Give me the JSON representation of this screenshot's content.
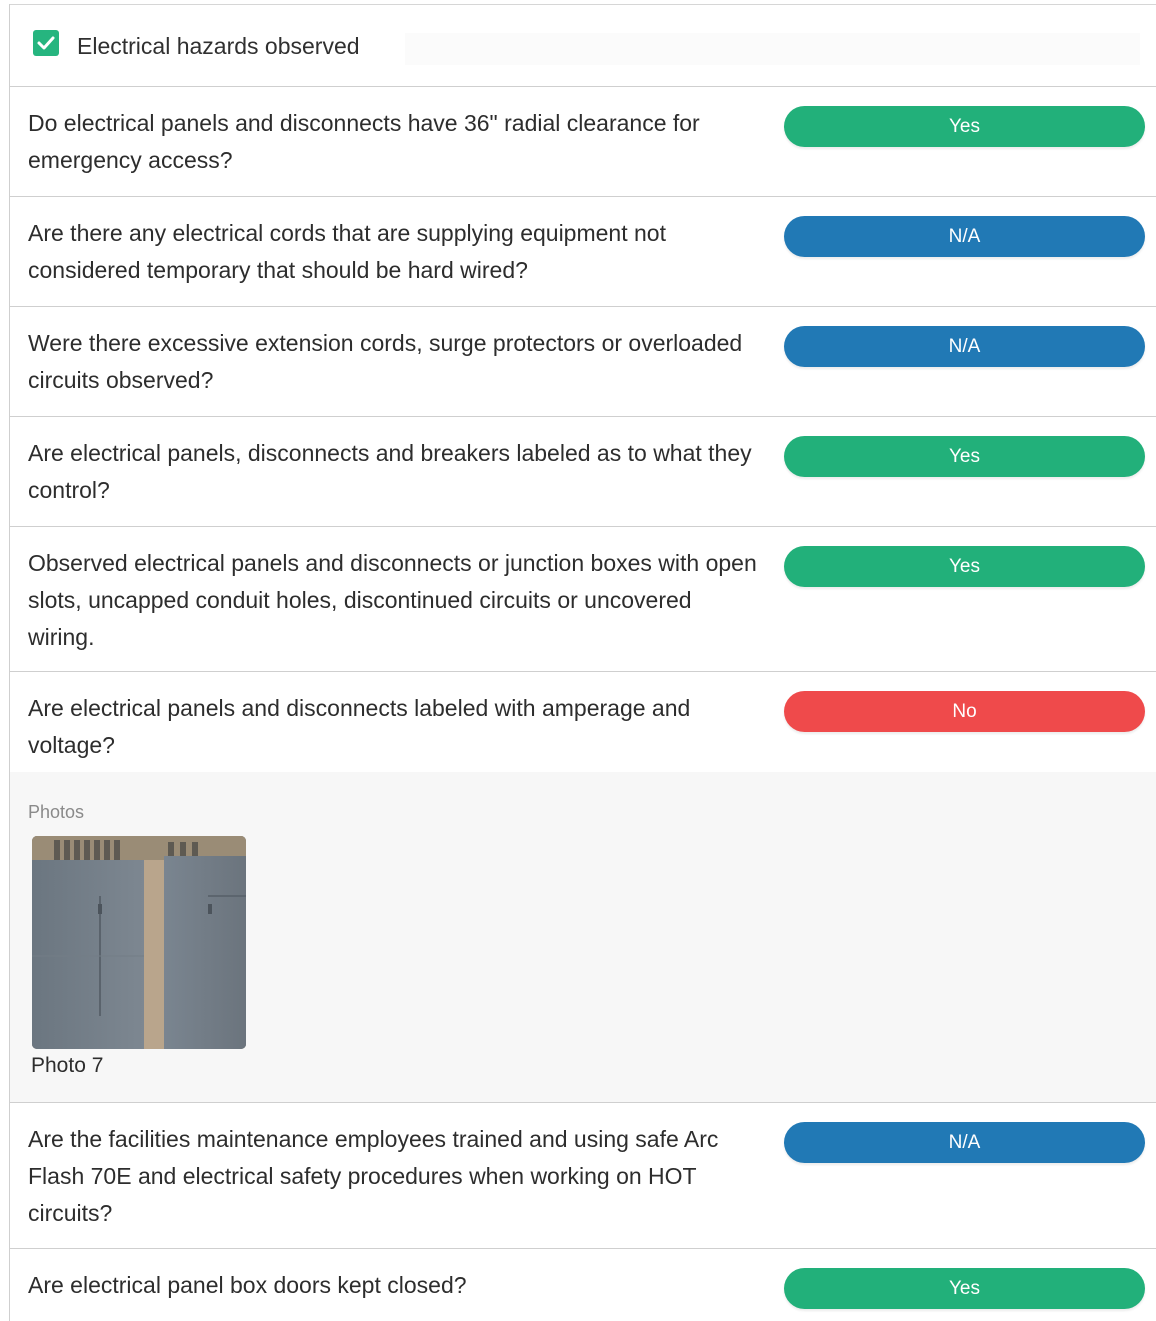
{
  "section": {
    "title": "Electrical hazards observed",
    "checked": true,
    "check_color": "#26b57f"
  },
  "questions": [
    {
      "text": "Do electrical panels and disconnects have 36\" radial clearance for emergency access?",
      "answer": "Yes",
      "answer_color": "#22b07a"
    },
    {
      "text": "Are there any electrical cords that are supplying equipment not considered temporary that should be hard wired?",
      "answer": "N/A",
      "answer_color": "#2179b5"
    },
    {
      "text": "Were there excessive extension cords, surge protectors or overloaded circuits observed?",
      "answer": "N/A",
      "answer_color": "#2179b5"
    },
    {
      "text": "Are electrical panels, disconnects and breakers labeled as to what they control?",
      "answer": "Yes",
      "answer_color": "#22b07a"
    },
    {
      "text": "Observed electrical panels and disconnects or junction boxes with open slots, uncapped conduit holes, discontinued circuits or uncovered wiring.",
      "answer": "Yes",
      "answer_color": "#22b07a"
    },
    {
      "text": "Are electrical panels and disconnects labeled with amperage and voltage?",
      "answer": "No",
      "answer_color": "#ef4a4b",
      "photos_label": "Photos",
      "photos": [
        {
          "caption": "Photo 7"
        }
      ]
    },
    {
      "text": "Are the facilities maintenance employees trained and using safe Arc Flash 70E and electrical safety procedures when working on HOT circuits?",
      "answer": "N/A",
      "answer_color": "#2179b5"
    },
    {
      "text": "Are electrical panel box doors kept closed?",
      "answer": "Yes",
      "answer_color": "#22b07a"
    }
  ]
}
